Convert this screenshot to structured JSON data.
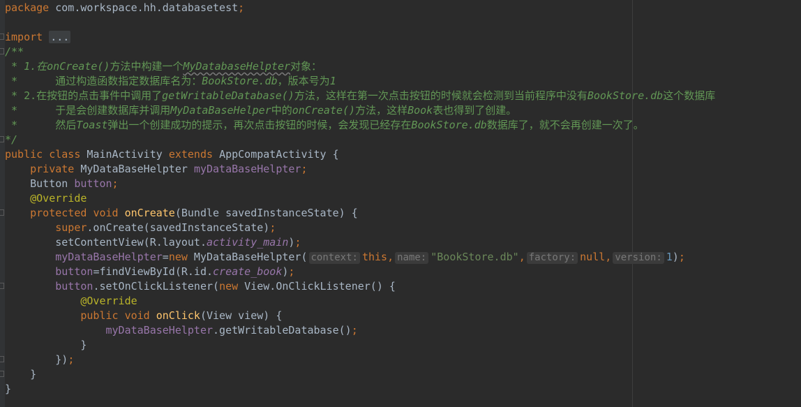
{
  "editor": {
    "lines": {
      "package": {
        "kw": "package",
        "name": "com.workspace.hh.databasetest",
        "semi": ";"
      },
      "import": {
        "kw": "import",
        "folded": "..."
      },
      "doc": {
        "open": "/**",
        "l1_pre": " * 1.在",
        "l1_i1": "onCreate()",
        "l1_mid": "方法中构建一个",
        "l1_i2": "MyDatabaseHelpter",
        "l1_post": "对象：",
        "l2_pre": " *      通过构造函数指定数据库名为：",
        "l2_i1": "BookStore.db",
        "l2_mid": "，版本号为",
        "l2_i2": "1",
        "l3_pre": " * 2.在按钮的点击事件中调用了",
        "l3_i1": "getWritableDatabase()",
        "l3_mid": "方法，这样在第一次点击按钮的时候就会检测到当前程序中没有",
        "l3_i2": "BookStore.db",
        "l3_post": "这个数据库",
        "l4_pre": " *      于是会创建数据库并调用",
        "l4_i1": "MyDataBaseHelper",
        "l4_mid": "中的",
        "l4_i2": "onCreate()",
        "l4_mid2": "方法，这样",
        "l4_i3": "Book",
        "l4_post": "表也得到了创建。",
        "l5_pre": " *      然后",
        "l5_i1": "Toast",
        "l5_mid": "弹出一个创建成功的提示，再次点击按钮的时候，会发现已经存在",
        "l5_i2": "BookStore.db",
        "l5_post": "数据库了，就不会再创建一次了。",
        "close": "*/"
      },
      "class_decl": {
        "k1": "public",
        "k2": "class",
        "name": "MainActivity",
        "k3": "extends",
        "parent": "AppCompatActivity",
        "brace": "{"
      },
      "field1": {
        "kw": "private",
        "type": "MyDataBaseHelpter",
        "name": "myDataBaseHelpter",
        "semi": ";"
      },
      "field2": {
        "type": "Button",
        "name": "button",
        "semi": ";"
      },
      "override1": "@Override",
      "oncreate_decl": {
        "k1": "protected",
        "k2": "void",
        "name": "onCreate",
        "params": "(Bundle savedInstanceState) {"
      },
      "super_call": {
        "kw": "super",
        "rest": ".onCreate(savedInstanceState)",
        "semi": ";"
      },
      "setcontent": {
        "pre": "setContentView(R.layout.",
        "field": "activity_main",
        "post": ")",
        "semi": ";"
      },
      "assign": {
        "target": "myDataBaseHelpter",
        "eq": "=",
        "kw": "new",
        "ctor": " MyDataBaseHelpter(",
        "hint1": "context:",
        "v1": "this",
        "c1": ",",
        "hint2": "name:",
        "v2": "\"BookStore.db\"",
        "c2": ",",
        "hint3": "factory:",
        "v3": "null",
        "c3": ",",
        "hint4": "version:",
        "v4": "1",
        "close": ")",
        "semi": ";"
      },
      "findview": {
        "target": "button",
        "pre": "=findViewById(R.id.",
        "field": "create_book",
        "post": ")",
        "semi": ";"
      },
      "listener": {
        "target": "button",
        "pre": ".setOnClickListener(",
        "kw": "new",
        "post": " View.OnClickListener() {"
      },
      "override2": "@Override",
      "onclick_decl": {
        "k1": "public",
        "k2": "void",
        "name": "onClick",
        "params": "(View view) {"
      },
      "getwritable": {
        "target": "myDataBaseHelpter",
        "rest": ".getWritableDatabase()",
        "semi": ";"
      },
      "close_inner": "}",
      "close_listener": {
        "text": "})",
        "semi": ";"
      },
      "close_method": "}",
      "close_class": "}"
    }
  },
  "colors": {
    "background": "#2b2b2b",
    "keyword": "#cc7832",
    "comment": "#629755",
    "field": "#9876aa",
    "function": "#ffc66d",
    "string": "#6a8759",
    "number": "#6897bb",
    "annotation": "#bbb529",
    "text": "#a9b7c6"
  }
}
